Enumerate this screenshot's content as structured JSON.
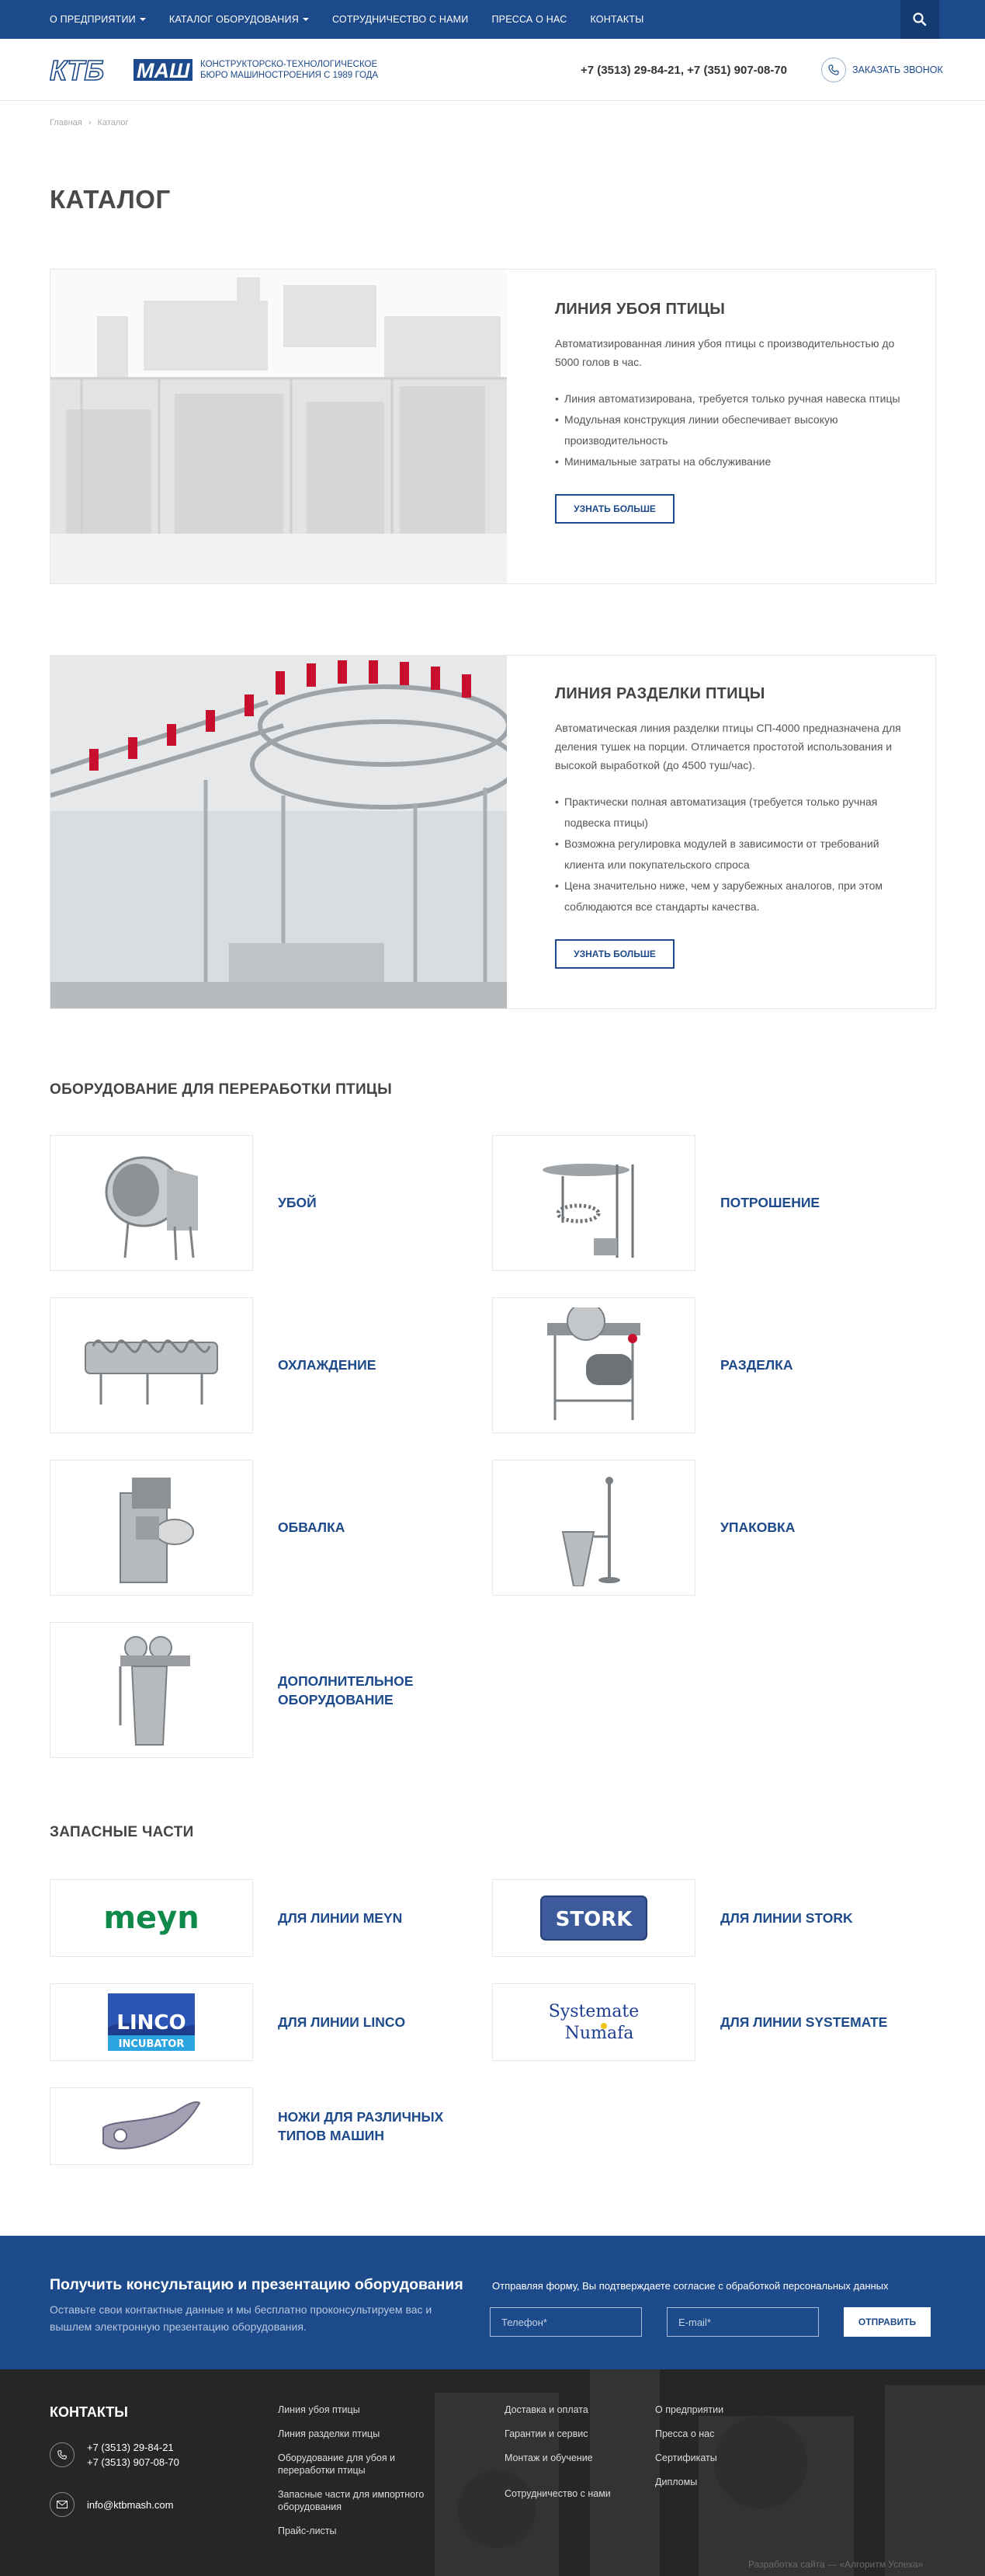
{
  "topnav": {
    "items": [
      {
        "label": "О ПРЕДПРИЯТИИ",
        "dropdown": true
      },
      {
        "label": "КАТАЛОГ ОБОРУДОВАНИЯ",
        "dropdown": true
      },
      {
        "label": "СОТРУДНИЧЕСТВО С НАМИ",
        "dropdown": false
      },
      {
        "label": "ПРЕССА О НАС",
        "dropdown": false
      },
      {
        "label": "КОНТАКТЫ",
        "dropdown": false
      }
    ],
    "search_icon": "search-icon"
  },
  "header": {
    "logo_letters_1": "КТБ",
    "logo_letters_2": "МАШ",
    "logo_line1": "КОНСТРУКТОРСКО-ТЕХНОЛОГИЧЕСКОЕ",
    "logo_line2": "БЮРО МАШИНОСТРОЕНИЯ С 1989 ГОДА",
    "phones": "+7 (3513) 29-84-21, +7 (351) 907-08-70",
    "callback_label": "ЗАКАЗАТЬ ЗВОНОК"
  },
  "breadcrumb": {
    "home": "Главная",
    "separator": "›",
    "current": "Каталог"
  },
  "page_title": "КАТАЛОГ",
  "lines": [
    {
      "title": "ЛИНИЯ УБОЯ ПТИЦЫ",
      "desc": "Автоматизированная линия убоя птицы с производительностью до 5000 голов в час.",
      "bullets": [
        "Линия автоматизирована, требуется только ручная навеска птицы",
        "Модульная конструкция линии обеспечивает высокую производительность",
        "Минимальные затраты на обслуживание"
      ],
      "button": "УЗНАТЬ БОЛЬШЕ"
    },
    {
      "title": "ЛИНИЯ РАЗДЕЛКИ ПТИЦЫ",
      "desc": "Автоматическая линия разделки птицы СП-4000 предназначена для деления тушек на порции. Отличается простотой использования и высокой выработкой (до 4500 туш/час).",
      "bullets": [
        "Практически полная автоматизация (требуется только ручная подвеска птицы)",
        "Возможна регулировка модулей в зависимости от требований клиента или покупательского спроса",
        "Цена значительно ниже, чем у зарубежных аналогов, при этом соблюдаются все стандарты качества."
      ],
      "button": "УЗНАТЬ БОЛЬШЕ"
    }
  ],
  "equipment": {
    "title": "ОБОРУДОВАНИЕ ДЛЯ ПЕРЕРАБОТКИ ПТИЦЫ",
    "items": [
      {
        "label": "УБОЙ"
      },
      {
        "label": "ПОТРОШЕНИЕ"
      },
      {
        "label": "ОХЛАЖДЕНИЕ"
      },
      {
        "label": "РАЗДЕЛКА"
      },
      {
        "label": "ОБВАЛКА"
      },
      {
        "label": "УПАКОВКА"
      },
      {
        "label": "ДОПОЛНИТЕЛЬНОЕ ОБОРУДОВАНИЕ"
      }
    ]
  },
  "spare": {
    "title": "ЗАПАСНЫЕ ЧАСТИ",
    "items": [
      {
        "label": "ДЛЯ ЛИНИИ MEYN",
        "logo": "meyn"
      },
      {
        "label": "ДЛЯ ЛИНИИ STORK",
        "logo": "STORK"
      },
      {
        "label": "ДЛЯ ЛИНИИ LINCO",
        "logo": "LINCO"
      },
      {
        "label": "ДЛЯ ЛИНИИ SYSTEMATE",
        "logo": "Systemate Numafa"
      },
      {
        "label": "НОЖИ ДЛЯ РАЗЛИЧНЫХ ТИПОВ МАШИН",
        "logo": ""
      }
    ],
    "logo_linco_sub": "INCUBATOR",
    "logo_systemate_1": "Systemate",
    "logo_systemate_2": "Numafa"
  },
  "cta": {
    "title": "Получить консультацию и презентацию оборудования",
    "text": "Оставьте свои контактные данные и мы бесплатно проконсультируем вас и вышлем электронную презентацию оборудования.",
    "consent": "Отправляя форму, Вы подтверждаете согласие с обработкой персональных данных",
    "phone_placeholder": "Телефон*",
    "email_placeholder": "E-mail*",
    "send": "ОТПРАВИТЬ"
  },
  "footer": {
    "title": "КОНТАКТЫ",
    "phone1": "+7 (3513) 29-84-21",
    "phone2": "+7 (3513) 907-08-70",
    "email": "info@ktbmash.com",
    "col1": [
      "Линия убоя птицы",
      "Линия разделки птицы",
      "Оборудование для убоя и переработки птицы",
      "Запасные части для импортного оборудования",
      "Прайс-листы"
    ],
    "col2": [
      "Доставка и оплата",
      "Гарантии и сервис",
      "Монтаж и обучение",
      "Сотрудничество с нами"
    ],
    "col3": [
      "О предприятии",
      "Пресса о нас",
      "Сертификаты",
      "Дипломы"
    ],
    "developer": "Разработка сайта — «Алгоритм Успеха»"
  },
  "colors": {
    "brand": "#1d4a8a",
    "footer": "#2a2a2a",
    "meyn_green": "#0f8a4a",
    "stork_blue": "#3d5a9a"
  }
}
